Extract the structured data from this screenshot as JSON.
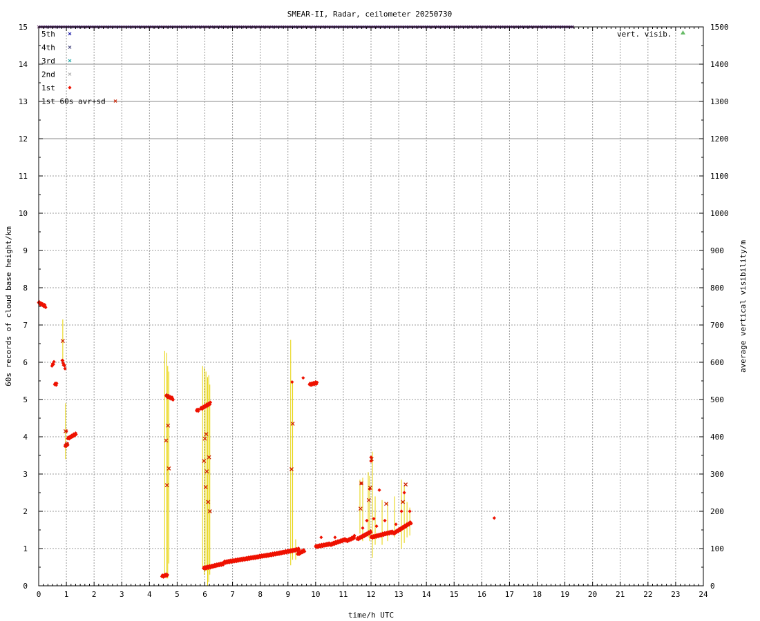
{
  "chart_data": {
    "type": "scatter",
    "title": "SMEAR-II, Radar, ceilometer 20250730",
    "xlabel": "time/h UTC",
    "ylabel": "60s records of cloud base height/km",
    "y2label": "average vertical visibility/m",
    "xlim": [
      0,
      24
    ],
    "ylim": [
      0,
      15
    ],
    "y2lim": [
      0,
      1500
    ],
    "x_ticks": [
      "0",
      "1",
      "2",
      "3",
      "4",
      "5",
      "6",
      "7",
      "8",
      "9",
      "10",
      "11",
      "12",
      "13",
      "14",
      "15",
      "16",
      "17",
      "18",
      "19",
      "20",
      "21",
      "22",
      "23",
      "24"
    ],
    "y_ticks": [
      "0",
      "1",
      "2",
      "3",
      "4",
      "5",
      "6",
      "7",
      "8",
      "9",
      "10",
      "11",
      "12",
      "13",
      "14",
      "15"
    ],
    "y2_ticks": [
      "0",
      "100",
      "200",
      "300",
      "400",
      "500",
      "600",
      "700",
      "800",
      "900",
      "1000",
      "1100",
      "1200",
      "1300",
      "1400",
      "1500"
    ],
    "grid": true,
    "colors": {
      "fifth": "#1a1aa8",
      "fourth": "#4a4a80",
      "third": "#22aaaa",
      "second": "#b0b0b0",
      "first": "#ee1100",
      "avg": "#cc2200",
      "sd": "#e6d200",
      "vis": "#66bb66"
    },
    "legend": [
      {
        "label": "5th",
        "key": "fifth",
        "marker": "x"
      },
      {
        "label": "4th",
        "key": "fourth",
        "marker": "x"
      },
      {
        "label": "3rd",
        "key": "third",
        "marker": "x"
      },
      {
        "label": "2nd",
        "key": "second",
        "marker": "x"
      },
      {
        "label": "1st",
        "key": "first",
        "marker": "diamond"
      },
      {
        "label": "1st 60s avr+sd",
        "key": "avg",
        "marker": "x"
      }
    ],
    "legend_right": {
      "label": "vert. visib.",
      "key": "vis",
      "marker": "triangle"
    },
    "top_band": {
      "x_start": 0,
      "x_end": 19.3,
      "y": 15
    },
    "first_segments": [
      [
        0.0,
        0.25,
        7.6,
        7.5
      ],
      [
        0.48,
        0.55,
        5.9,
        6.0
      ],
      [
        0.58,
        0.65,
        5.4,
        5.42
      ],
      [
        0.85,
        0.95,
        6.05,
        5.85
      ],
      [
        0.95,
        1.05,
        3.75,
        3.8
      ],
      [
        1.05,
        1.35,
        3.95,
        4.08
      ],
      [
        4.45,
        4.65,
        0.25,
        0.3
      ],
      [
        4.6,
        4.85,
        5.1,
        5.02
      ],
      [
        5.7,
        5.78,
        4.7,
        4.72
      ],
      [
        5.85,
        6.2,
        4.75,
        4.9
      ],
      [
        5.95,
        6.7,
        0.47,
        0.6
      ],
      [
        6.7,
        8.5,
        0.63,
        0.85
      ],
      [
        8.5,
        9.4,
        0.85,
        0.98
      ],
      [
        9.35,
        9.6,
        0.85,
        0.95
      ],
      [
        9.78,
        10.05,
        5.4,
        5.45
      ],
      [
        10.0,
        10.5,
        1.05,
        1.12
      ],
      [
        10.5,
        11.1,
        1.1,
        1.25
      ],
      [
        11.1,
        11.4,
        1.2,
        1.3
      ],
      [
        11.5,
        12.0,
        1.25,
        1.45
      ],
      [
        12.0,
        12.8,
        1.3,
        1.45
      ],
      [
        12.8,
        13.45,
        1.4,
        1.7
      ]
    ],
    "first_points": [
      [
        1.0,
        4.15
      ],
      [
        9.15,
        5.47
      ],
      [
        9.55,
        5.58
      ],
      [
        11.65,
        2.75
      ],
      [
        11.95,
        2.6
      ],
      [
        12.0,
        3.35
      ],
      [
        12.0,
        3.45
      ],
      [
        12.3,
        2.57
      ],
      [
        12.5,
        1.75
      ],
      [
        12.9,
        1.65
      ],
      [
        13.2,
        2.5
      ],
      [
        13.1,
        2.0
      ],
      [
        11.7,
        1.55
      ],
      [
        11.85,
        1.75
      ],
      [
        12.1,
        1.8
      ],
      [
        12.2,
        1.6
      ],
      [
        10.2,
        1.3
      ],
      [
        10.7,
        1.3
      ],
      [
        11.4,
        1.35
      ],
      [
        13.4,
        2.0
      ],
      [
        16.45,
        1.82
      ]
    ],
    "avg_points": [
      [
        0.87,
        6.57
      ],
      [
        0.97,
        4.15
      ],
      [
        1.02,
        3.8
      ],
      [
        4.6,
        3.9
      ],
      [
        4.63,
        2.7
      ],
      [
        4.67,
        4.3
      ],
      [
        4.7,
        3.15
      ],
      [
        4.65,
        5.1
      ],
      [
        5.97,
        3.35
      ],
      [
        6.0,
        3.95
      ],
      [
        6.03,
        2.65
      ],
      [
        6.05,
        4.07
      ],
      [
        6.07,
        3.07
      ],
      [
        6.12,
        2.25
      ],
      [
        6.15,
        3.45
      ],
      [
        6.18,
        2.0
      ],
      [
        9.13,
        3.13
      ],
      [
        9.17,
        4.35
      ],
      [
        11.62,
        2.07
      ],
      [
        11.65,
        2.75
      ],
      [
        11.92,
        2.3
      ],
      [
        11.97,
        2.63
      ],
      [
        12.02,
        3.4
      ],
      [
        12.55,
        2.2
      ],
      [
        13.15,
        2.25
      ],
      [
        13.25,
        2.72
      ]
    ],
    "sd_bars": [
      [
        0.87,
        5.9,
        7.15
      ],
      [
        0.97,
        3.4,
        4.9
      ],
      [
        4.55,
        0.3,
        6.3
      ],
      [
        4.62,
        0.2,
        6.25
      ],
      [
        4.66,
        0.2,
        5.9
      ],
      [
        4.7,
        0.6,
        5.75
      ],
      [
        5.92,
        0.5,
        5.9
      ],
      [
        5.98,
        0.3,
        5.85
      ],
      [
        6.04,
        0.4,
        5.75
      ],
      [
        6.1,
        0.0,
        5.6
      ],
      [
        6.14,
        0.1,
        5.65
      ],
      [
        6.18,
        0.3,
        5.4
      ],
      [
        9.1,
        0.55,
        6.6
      ],
      [
        9.17,
        0.7,
        5.5
      ],
      [
        9.28,
        0.7,
        1.25
      ],
      [
        11.6,
        1.4,
        2.85
      ],
      [
        11.7,
        1.2,
        2.9
      ],
      [
        11.9,
        1.3,
        3.05
      ],
      [
        11.95,
        1.2,
        2.95
      ],
      [
        12.05,
        0.75,
        3.6
      ],
      [
        12.15,
        1.1,
        2.4
      ],
      [
        12.4,
        1.1,
        2.3
      ],
      [
        12.6,
        1.2,
        2.25
      ],
      [
        12.85,
        1.3,
        2.4
      ],
      [
        13.1,
        1.0,
        2.85
      ],
      [
        13.2,
        1.15,
        2.7
      ],
      [
        13.3,
        1.3,
        2.25
      ],
      [
        13.4,
        1.35,
        2.1
      ]
    ]
  }
}
